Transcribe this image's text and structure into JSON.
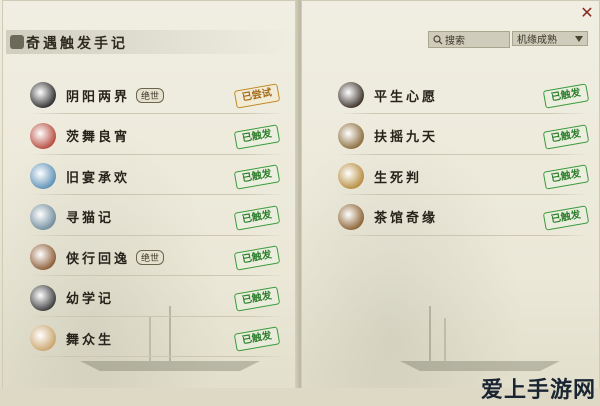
{
  "window": {
    "title": "奇遇触发手记",
    "close_icon": "close-icon"
  },
  "search": {
    "label": "搜索",
    "icon": "search-icon"
  },
  "sort": {
    "label": "机缘成熟",
    "icon": "dropdown-icon"
  },
  "left_list": [
    {
      "name": "阴阳两界",
      "tag": "绝世",
      "status": "已尝试",
      "status_type": "tried",
      "icon": "yin-yang-icon",
      "icon_color": "#2b2b2b"
    },
    {
      "name": "茨舞良宵",
      "tag": "",
      "status": "已触发",
      "status_type": "triggered",
      "icon": "mask-icon",
      "icon_color": "#b5473a"
    },
    {
      "name": "旧宴承欢",
      "tag": "",
      "status": "已触发",
      "status_type": "triggered",
      "icon": "feather-icon",
      "icon_color": "#5a8fb5"
    },
    {
      "name": "寻猫记",
      "tag": "",
      "status": "已触发",
      "status_type": "triggered",
      "icon": "cat-icon",
      "icon_color": "#6d8a9a"
    },
    {
      "name": "侠行回逸",
      "tag": "绝世",
      "status": "已触发",
      "status_type": "triggered",
      "icon": "house-icon",
      "icon_color": "#8a5a32"
    },
    {
      "name": "幼学记",
      "tag": "",
      "status": "已触发",
      "status_type": "triggered",
      "icon": "paw-icon",
      "icon_color": "#3a3a3a"
    },
    {
      "name": "舞众生",
      "tag": "",
      "status": "已触发",
      "status_type": "triggered",
      "icon": "cat-face-icon",
      "icon_color": "#c9a36a"
    }
  ],
  "right_list": [
    {
      "name": "平生心愿",
      "tag": "",
      "status": "已触发",
      "status_type": "triggered",
      "icon": "scholar-icon",
      "icon_color": "#3a2f28"
    },
    {
      "name": "扶摇九天",
      "tag": "",
      "status": "已触发",
      "status_type": "triggered",
      "icon": "pavilion-icon",
      "icon_color": "#8a6a3a"
    },
    {
      "name": "生死判",
      "tag": "",
      "status": "已触发",
      "status_type": "triggered",
      "icon": "brush-icon",
      "icon_color": "#b58a3a"
    },
    {
      "name": "茶馆奇缘",
      "tag": "",
      "status": "已触发",
      "status_type": "triggered",
      "icon": "teahouse-icon",
      "icon_color": "#8a6030"
    }
  ],
  "watermark": "爱上手游网"
}
